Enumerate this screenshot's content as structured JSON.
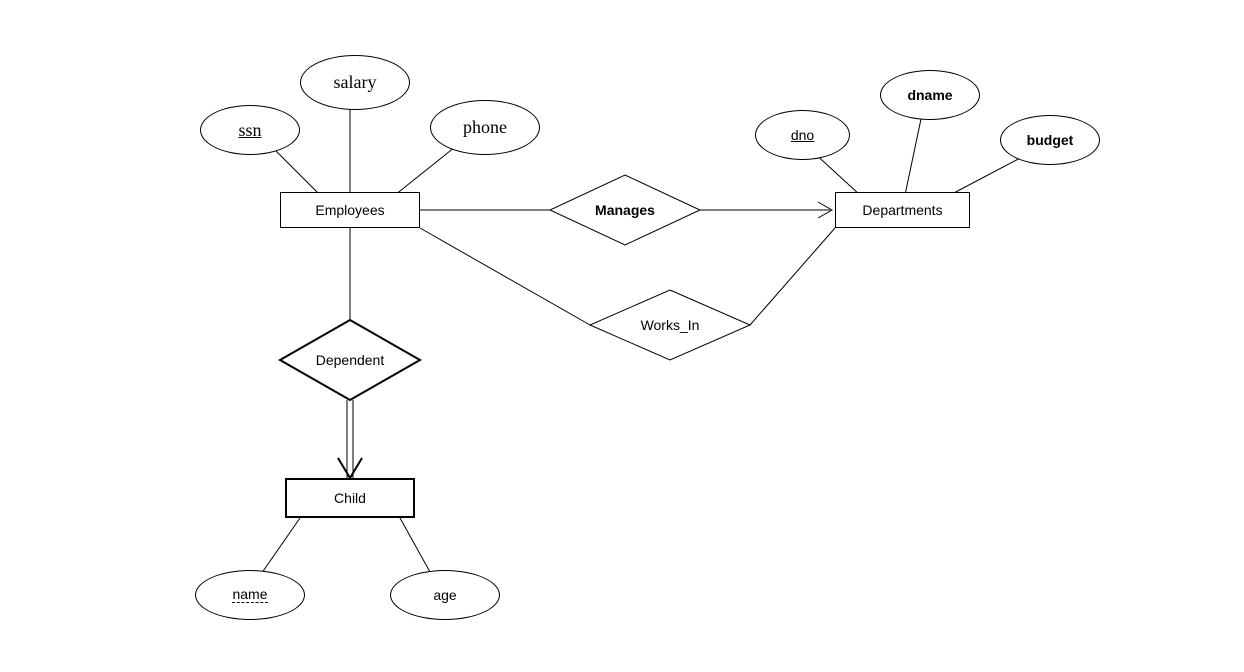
{
  "entities": {
    "employees": "Employees",
    "departments": "Departments",
    "child": "Child"
  },
  "relationships": {
    "manages": "Manages",
    "works_in": "Works_In",
    "dependent": "Dependent"
  },
  "attributes": {
    "ssn": "ssn",
    "salary": "salary",
    "phone": "phone",
    "dno": "dno",
    "dname": "dname",
    "budget": "budget",
    "name": "name",
    "age": "age"
  },
  "diagram": {
    "type": "ER",
    "entities": [
      {
        "name": "Employees",
        "key": "ssn",
        "attributes": [
          "ssn",
          "salary",
          "phone"
        ]
      },
      {
        "name": "Departments",
        "key": "dno",
        "attributes": [
          "dno",
          "dname",
          "budget"
        ]
      },
      {
        "name": "Child",
        "weak": true,
        "partial_key": "name",
        "attributes": [
          "name",
          "age"
        ],
        "owner": "Employees",
        "identifying_relationship": "Dependent"
      }
    ],
    "relationships": [
      {
        "name": "Manages",
        "between": [
          "Employees",
          "Departments"
        ],
        "arrow_to": "Departments"
      },
      {
        "name": "Works_In",
        "between": [
          "Employees",
          "Departments"
        ]
      },
      {
        "name": "Dependent",
        "between": [
          "Employees",
          "Child"
        ],
        "identifying": true,
        "arrow_to": "Child"
      }
    ]
  }
}
